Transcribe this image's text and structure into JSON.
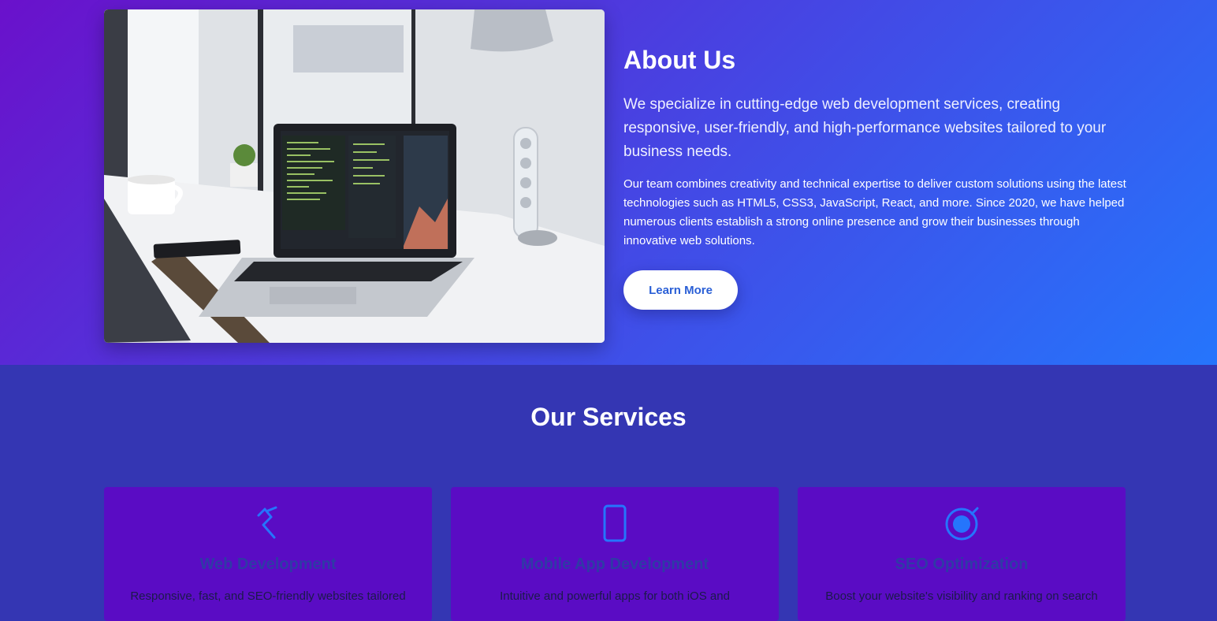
{
  "about": {
    "title": "About Us",
    "lead": "We specialize in cutting-edge web development services, creating responsive, user-friendly, and high-performance websites tailored to your business needs.",
    "body": "Our team combines creativity and technical expertise to deliver custom solutions using the latest technologies such as HTML5, CSS3, JavaScript, React, and more. Since 2020, we have helped numerous clients establish a strong online presence and grow their businesses through innovative web solutions.",
    "button_label": "Learn More"
  },
  "services": {
    "title": "Our Services",
    "cards": [
      {
        "icon": "code-icon",
        "title": "Web Development",
        "description": "Responsive, fast, and SEO-friendly websites tailored"
      },
      {
        "icon": "mobile-icon",
        "title": "Mobile App Development",
        "description": "Intuitive and powerful apps for both iOS and"
      },
      {
        "icon": "target-icon",
        "title": "SEO Optimization",
        "description": "Boost your website's visibility and ranking on search"
      }
    ]
  },
  "colors": {
    "gradient_start": "#6a11cb",
    "gradient_end": "#2575fc",
    "services_background": "#3436b3",
    "card_background": "#5a0cc4",
    "accent": "#2575fc"
  }
}
